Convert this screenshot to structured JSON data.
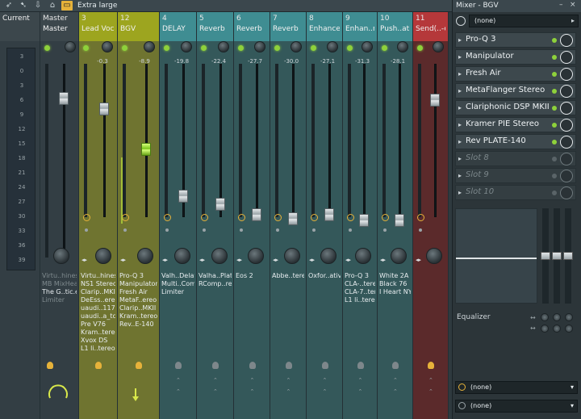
{
  "toolbar": {
    "size_label": "Extra large"
  },
  "scale_labels": [
    "3",
    "0",
    "3",
    "6",
    "9",
    "12",
    "15",
    "18",
    "21",
    "24",
    "27",
    "30",
    "33",
    "36",
    "39"
  ],
  "current": {
    "number": "",
    "name": "Current"
  },
  "master": {
    "number": "",
    "name": "Master",
    "label": "Master",
    "fx": [
      "Virtu..hines",
      "MB MixHead",
      "The G..tic.e",
      "Limiter"
    ],
    "fx_dim": [
      true,
      true,
      false,
      true
    ]
  },
  "tracks": [
    {
      "number": "3",
      "name": "Lead Vocal",
      "value": "-0.3",
      "fx": [
        "Virtu..hines",
        "NS1 Stereo",
        "Clarip..MKII",
        "DeEss..ereo",
        "uaudi..1176",
        "uaudi..a_tc",
        "Pre V76",
        "Kram..tereo",
        "Xvox DS",
        "L1 li..tereo"
      ]
    },
    {
      "number": "12",
      "name": "BGV",
      "value": "-8.9",
      "fx": [
        "Pro-Q 3",
        "Manipulator",
        "Fresh Air",
        "MetaF..ereo",
        "Clarip..MKII",
        "Kram..tereo",
        "Rev..E-140"
      ]
    },
    {
      "number": "4",
      "name": "DELAY",
      "value": "-19.8",
      "fx": [
        "Valh..Delay",
        "Multi..Comp",
        "Limiter"
      ]
    },
    {
      "number": "5",
      "name": "Reverb",
      "value": "-22.4",
      "fx": [
        "Valha..Plate",
        "RComp..reo"
      ]
    },
    {
      "number": "6",
      "name": "Reverb",
      "value": "-27.7",
      "fx": [
        "Eos 2"
      ]
    },
    {
      "number": "7",
      "name": "Reverb",
      "value": "-30.0",
      "fx": [
        "Abbe..tereo"
      ]
    },
    {
      "number": "8",
      "name": "Enhance",
      "value": "-27.1",
      "fx": [
        "Oxfor..ative"
      ]
    },
    {
      "number": "9",
      "name": "Enhan..risp",
      "value": "-31.3",
      "fx": [
        "Pro-Q 3",
        "CLA-..tereo",
        "CLA-7..tereo",
        "L1 li..tereo"
      ]
    },
    {
      "number": "10",
      "name": "Push..ation",
      "value": "-28.1",
      "fx": [
        "White 2A",
        "Black 76",
        "I Heart NY"
      ]
    },
    {
      "number": "11",
      "name": "Send(..-off)",
      "value": "",
      "fx": []
    }
  ],
  "panel": {
    "title": "Mixer - BGV",
    "input": "(none)",
    "slots": [
      "Pro-Q 3",
      "Manipulator",
      "Fresh Air",
      "MetaFlanger Stereo",
      "Clariphonic DSP MKII",
      "Kramer PIE Stereo",
      "Rev PLATE-140",
      "Slot 8",
      "Slot 9",
      "Slot 10"
    ],
    "eq_label": "Equalizer",
    "output1": "(none)",
    "output2": "(none)"
  },
  "colors": {
    "bg": "#2f3a3f",
    "yellow": "#6f7430",
    "yellow_hdr": "#9da51f",
    "teal": "#34585a",
    "teal_hdr": "#3f8d92",
    "red": "#5b2a2b",
    "red_hdr": "#b5383a",
    "accent": "#8ed13b",
    "clock": "#e6b23a"
  },
  "icons": [
    "arrow-tool-icon",
    "export-icon",
    "render-icon",
    "lock-icon",
    "size-icon",
    "scroll-arrow-icon",
    "led-icon",
    "knob-icon",
    "clock-icon",
    "bulb-icon",
    "chevron-icon"
  ]
}
